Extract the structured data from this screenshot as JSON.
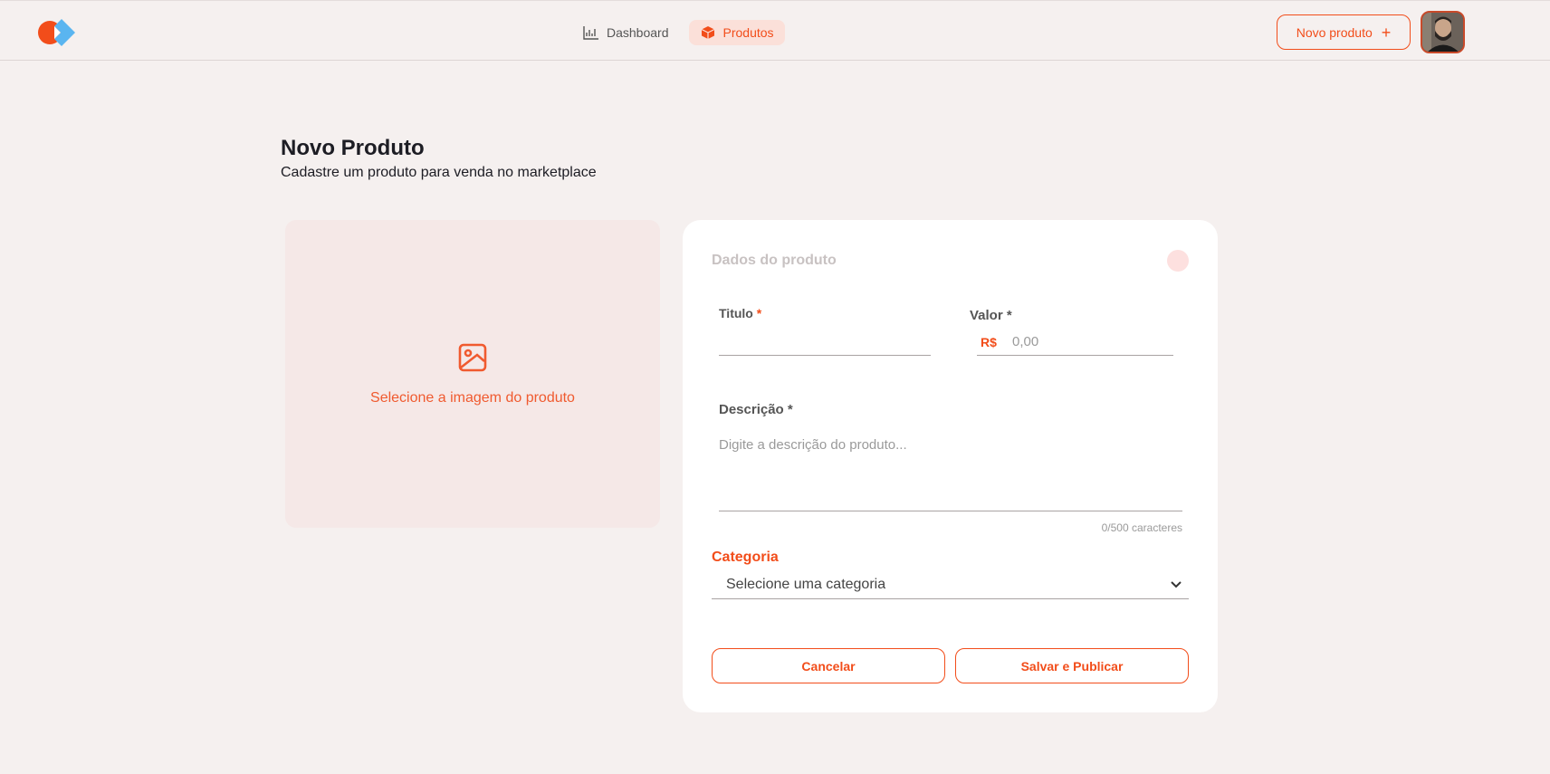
{
  "header": {
    "nav": [
      {
        "label": "Dashboard",
        "icon": "chart-icon"
      },
      {
        "label": "Produtos",
        "icon": "package-icon"
      }
    ],
    "new_product_label": "Novo produto",
    "new_product_icon": "plus-icon"
  },
  "page": {
    "title": "Novo Produto",
    "subtitle": "Cadastre um produto para venda no marketplace"
  },
  "image_picker": {
    "label": "Selecione a imagem do produto",
    "icon": "image-icon"
  },
  "form": {
    "section_title": "Dados do produto",
    "title_label": "Titulo",
    "title_required": "*",
    "title_value": "",
    "price_label": "Valor *",
    "price_currency": "R$",
    "price_placeholder": "0,00",
    "description_label": "Descrição *",
    "description_placeholder": "Digite a descrição do produto...",
    "description_counter": "0/500 caracteres",
    "category_label": "Categoria",
    "category_selected": "Selecione uma categoria",
    "cancel_label": "Cancelar",
    "submit_label": "Salvar e Publicar"
  },
  "colors": {
    "accent": "#f24d1a",
    "background": "#f5f0ef",
    "picker_bg": "#f5e8e7",
    "card_bg": "#ffffff"
  }
}
